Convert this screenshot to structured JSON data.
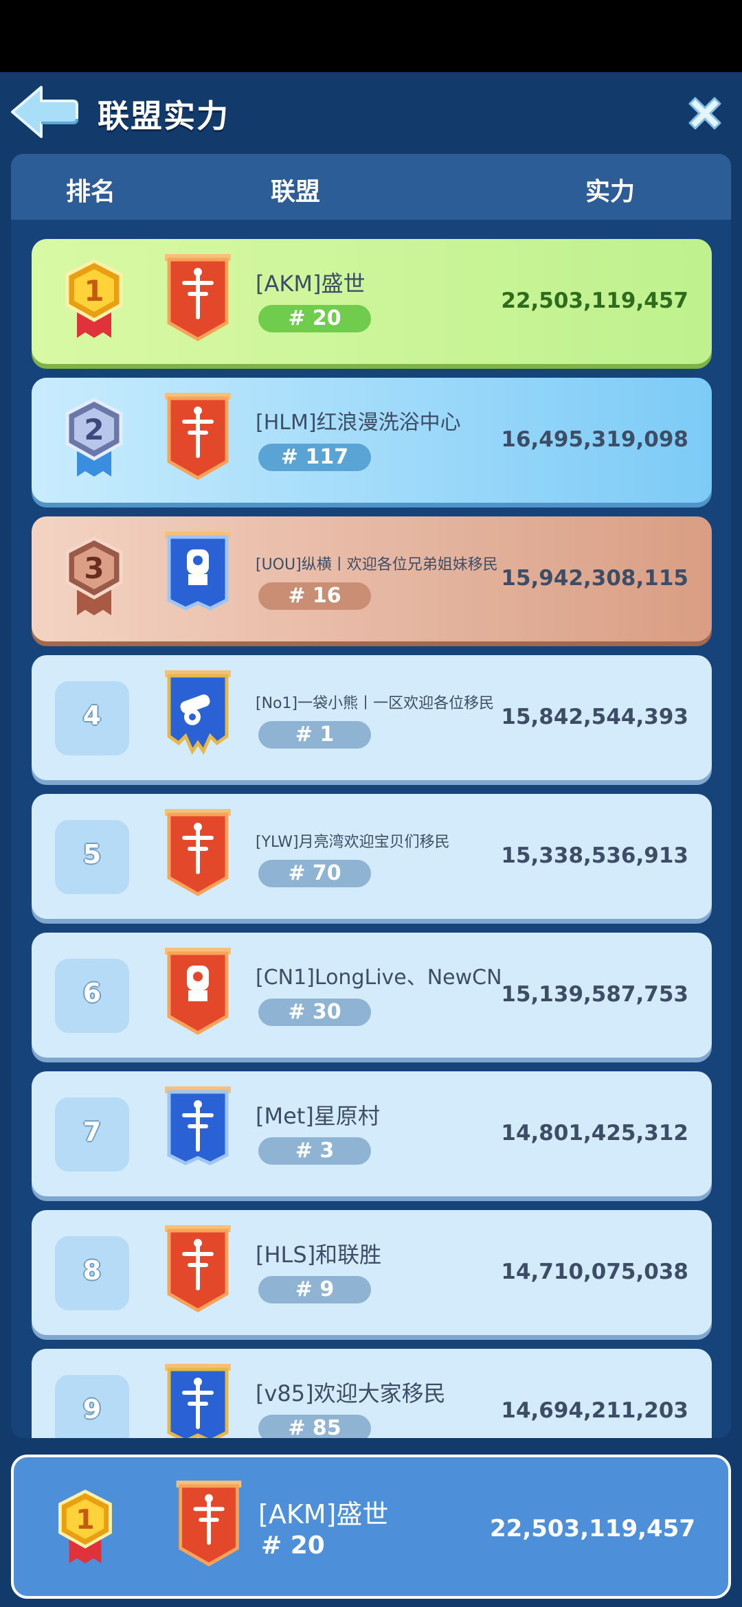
{
  "header": {
    "title": "联盟实力"
  },
  "columns": {
    "rank": "排名",
    "alliance": "联盟",
    "power": "实力"
  },
  "rows": [
    {
      "rank": "1",
      "name": "[AKM]盛世",
      "tag": "# 20",
      "power": "22,503,119,457",
      "banner": "red-scales"
    },
    {
      "rank": "2",
      "name": "[HLM]红浪漫洗浴中心",
      "tag": "# 117",
      "power": "16,495,319,098",
      "banner": "red-scales"
    },
    {
      "rank": "3",
      "name": "[UOU]纵横丨欢迎各位兄弟姐妹移民",
      "tag": "# 16",
      "power": "15,942,308,115",
      "banner": "blue-fist"
    },
    {
      "rank": "4",
      "name": "[No1]一袋小熊丨一区欢迎各位移民",
      "tag": "# 1",
      "power": "15,842,544,393",
      "banner": "blue-cannon"
    },
    {
      "rank": "5",
      "name": "[YLW]月亮湾欢迎宝贝们移民",
      "tag": "# 70",
      "power": "15,338,536,913",
      "banner": "red-scales"
    },
    {
      "rank": "6",
      "name": "[CN1]LongLive、NewCN",
      "tag": "# 30",
      "power": "15,139,587,753",
      "banner": "red-fist"
    },
    {
      "rank": "7",
      "name": "[Met]星原村",
      "tag": "# 3",
      "power": "14,801,425,312",
      "banner": "blue-scales"
    },
    {
      "rank": "8",
      "name": "[HLS]和联胜",
      "tag": "# 9",
      "power": "14,710,075,038",
      "banner": "red-scales"
    },
    {
      "rank": "9",
      "name": "[v85]欢迎大家移民",
      "tag": "# 85",
      "power": "14,694,211,203",
      "banner": "blue-scales"
    }
  ],
  "my_alliance": {
    "rank": "1",
    "name": "[AKM]盛世",
    "tag": "# 20",
    "power": "22,503,119,457"
  },
  "colors": {
    "background": "#123a6b",
    "gold_row": "#c8f59a",
    "silver_row": "#8ad0f8",
    "bronze_row": "#e0ae95",
    "plain_row": "#d3ebfb"
  }
}
